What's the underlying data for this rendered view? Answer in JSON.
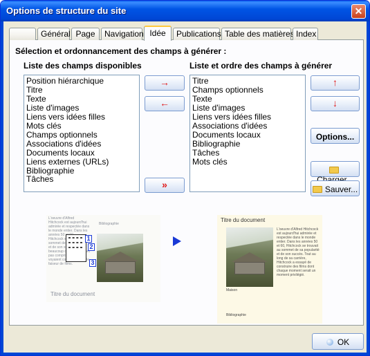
{
  "window": {
    "title": "Options de structure du site",
    "close_symbol": "✕"
  },
  "tabs": [
    {
      "label": ""
    },
    {
      "label": "Général"
    },
    {
      "label": "Page"
    },
    {
      "label": "Navigation"
    },
    {
      "label": "Idée"
    },
    {
      "label": "Publications"
    },
    {
      "label": "Table des matières"
    },
    {
      "label": "Index"
    }
  ],
  "active_tab": "Idée",
  "section_heading": "Sélection et ordonnancement des champs à générer :",
  "available": {
    "title": "Liste des champs disponibles",
    "items": [
      "Position hiérarchique",
      "Titre",
      "Texte",
      "Liste d'images",
      "Liens vers idées filles",
      "Mots clés",
      "Champs optionnels",
      "Associations d'idées",
      "Documents locaux",
      "Liens externes (URLs)",
      "Bibliographie",
      "Tâches"
    ]
  },
  "selected": {
    "title": "Liste et ordre des champs à générer",
    "items": [
      "Titre",
      "Champs optionnels",
      "Texte",
      "Liste d'images",
      "Liens vers idées filles",
      "Associations d'idées",
      "Documents locaux",
      "Bibliographie",
      "Tâches",
      "Mots clés"
    ]
  },
  "buttons": {
    "add_symbol": "→",
    "remove_symbol": "←",
    "add_all_symbol": "»",
    "up_symbol": "↑",
    "down_symbol": "↓",
    "options": "Options...",
    "load": "Charger...",
    "save": "Sauver...",
    "ok": "OK"
  },
  "preview_left": {
    "text": "L'oeuvre d'Alfred Hitchcock est aujourd'hui admirée et respectée dans le monde entier. Dans les années 50 et 60, Hitchcock se trouvait au sommet de sa popularité et de son succès, mais beaucoup de gens, n'ayant pas compris l'oeuvre, le voyaient comme un simple faiseur de films.",
    "biblio_label": "Bibliographie",
    "doc_title": "Titre du document",
    "badges": [
      "1",
      "2",
      "3"
    ]
  },
  "preview_right": {
    "doc_title": "Titre du document",
    "text": "L'oeuvre d'Alfred Hitchcock est aujourd'hui admirée et respectée dans le monde entier. Dans les années 50 et 60, Hitchcock se trouvait au sommet de sa popularité et de son succès. Tout au long de sa carrière, Hitchcock a essayé de construire des films dont chaque moment serait un moment privilégié.",
    "caption": "Maison",
    "biblio_label": "Bibliographie"
  },
  "colors": {
    "accent": "#0046d5",
    "arrow_red": "#e01818",
    "tab_highlight": "#ffc83c"
  }
}
